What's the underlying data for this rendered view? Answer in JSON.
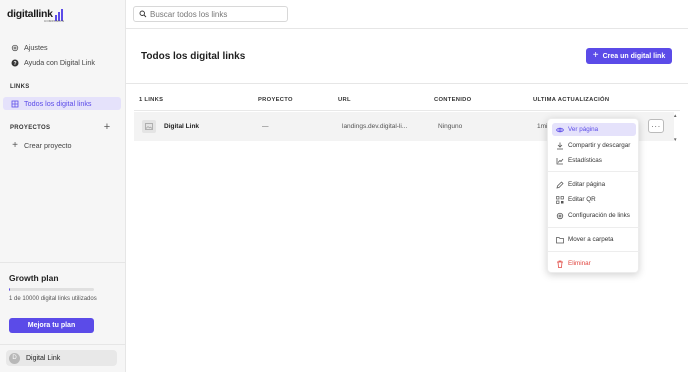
{
  "brand": {
    "name": "digitallink",
    "sub": "COMPANION",
    "accent": "#5b4be8"
  },
  "sidebar": {
    "items": [
      {
        "label": "Ajustes",
        "icon": "gear-icon"
      },
      {
        "label": "Ayuda con Digital Link",
        "icon": "help-icon"
      }
    ],
    "links_section": "LINKS",
    "links_items": [
      {
        "label": "Todos los digital links",
        "icon": "grid-icon",
        "active": true
      }
    ],
    "projects_section": "PROYECTOS",
    "create_project": "Crear proyecto",
    "plan": {
      "title": "Growth plan",
      "usage_fraction": 0.0001,
      "usage_text": "1 de 10000 digital links utilizados",
      "upgrade_label": "Mejora tu plan"
    },
    "user": {
      "initial": "D",
      "name": "Digital Link"
    }
  },
  "search": {
    "placeholder": "Buscar todos los links"
  },
  "main": {
    "title": "Todos los digital links",
    "create_label": "Crea un digital link"
  },
  "table": {
    "headers": [
      "1 LINKS",
      "PROYECTO",
      "URL",
      "CONTENIDO",
      "ULTIMA ACTUALIZACIÓN"
    ],
    "rows": [
      {
        "name": "Digital Link",
        "project": "—",
        "url": "landings.dev.digital-li...",
        "content": "Ninguno",
        "updated": "1min"
      }
    ]
  },
  "menu": {
    "items": [
      {
        "label": "Ver página",
        "icon": "eye-icon",
        "active": true
      },
      {
        "label": "Compartir y descargar",
        "icon": "download-icon"
      },
      {
        "label": "Estadísticas",
        "icon": "chart-icon"
      },
      {
        "label": "Editar página",
        "icon": "pencil-icon"
      },
      {
        "label": "Editar QR",
        "icon": "qr-icon"
      },
      {
        "label": "Configuración de links",
        "icon": "gear-icon"
      },
      {
        "label": "Mover a carpeta",
        "icon": "folder-icon"
      },
      {
        "label": "Eliminar",
        "icon": "trash-icon",
        "danger": true
      }
    ]
  }
}
